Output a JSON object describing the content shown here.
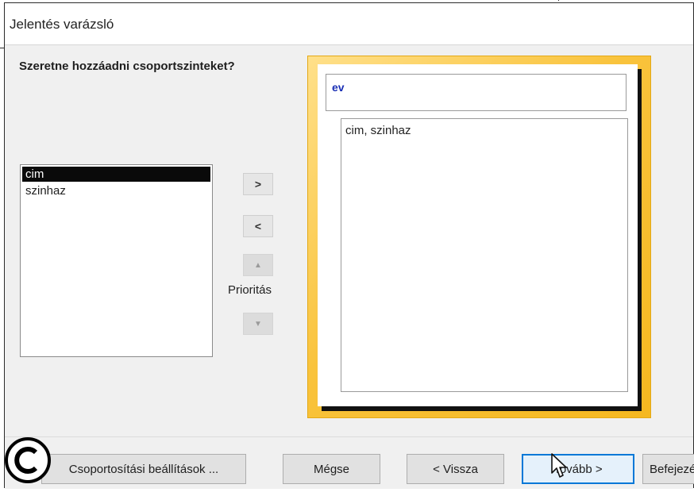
{
  "window": {
    "title": "Jelentés varázsló"
  },
  "prompt": {
    "question": "Szeretne hozzáadni csoportszinteket?"
  },
  "field_list": {
    "items": [
      {
        "label": "cim",
        "selected": true
      },
      {
        "label": "szinhaz",
        "selected": false
      }
    ]
  },
  "move_buttons": {
    "add": ">",
    "remove": "<",
    "priority_up": "▲",
    "priority_down": "▼",
    "priority_label": "Prioritás"
  },
  "preview": {
    "group_field": "ev",
    "detail_fields": "cim, szinhaz"
  },
  "footer": {
    "grouping_options": "Csoportosítási beállítások ...",
    "cancel": "Mégse",
    "back": "< Vissza",
    "next": "Tovább >",
    "finish": "Befejezés"
  },
  "colors": {
    "accent": "#0078d7",
    "group_text": "#1a2fb5",
    "preview_frame": "#f9c33c"
  },
  "icons": {
    "cursor": "mouse-pointer-icon",
    "copyright": "copyright-icon"
  }
}
